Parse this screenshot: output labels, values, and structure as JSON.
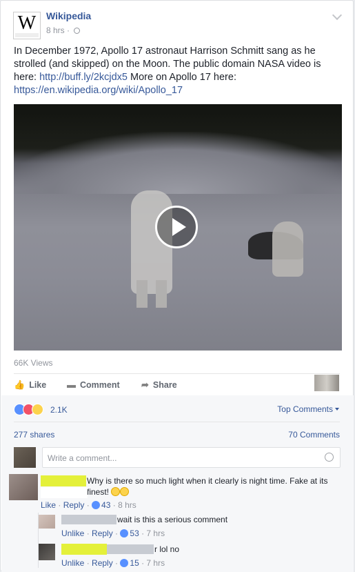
{
  "post": {
    "page_name": "Wikipedia",
    "logo_letter": "W",
    "time": "8 hrs",
    "text_parts": {
      "intro": "In December 1972, Apollo 17 astronaut Harrison Schmitt sang as he strolled (and skipped) on the Moon. The public domain NASA video is here: ",
      "link1": "http://buff.ly/2kcjdx5",
      "middle": " More on Apollo 17 here: ",
      "link2": "https://en.wikipedia.org/wiki/Apollo_17"
    },
    "views": "66K Views",
    "privacy_icon": "globe-icon"
  },
  "actions": {
    "like": "Like",
    "comment": "Comment",
    "share": "Share"
  },
  "stats": {
    "reactions_count": "2.1K",
    "reactions": [
      "like",
      "love",
      "wow"
    ],
    "top_comments": "Top Comments",
    "shares": "277 shares",
    "comments": "70 Comments"
  },
  "composer": {
    "placeholder": "Write a comment..."
  },
  "comments": [
    {
      "text": "Why is there so much light when it clearly is night time. Fake at its finest!",
      "like": "Like",
      "reply": "Reply",
      "likes": "43",
      "time": "8 hrs"
    }
  ],
  "replies": [
    {
      "text": "wait is this a serious comment",
      "unlike": "Unlike",
      "reply": "Reply",
      "likes": "53",
      "time": "7 hrs"
    },
    {
      "text": "r lol no",
      "unlike": "Unlike",
      "reply": "Reply",
      "likes": "15",
      "time": "7 hrs"
    }
  ],
  "colors": {
    "link": "#365899",
    "highlight": "#e4f03a",
    "like_blue": "#5890ff"
  }
}
